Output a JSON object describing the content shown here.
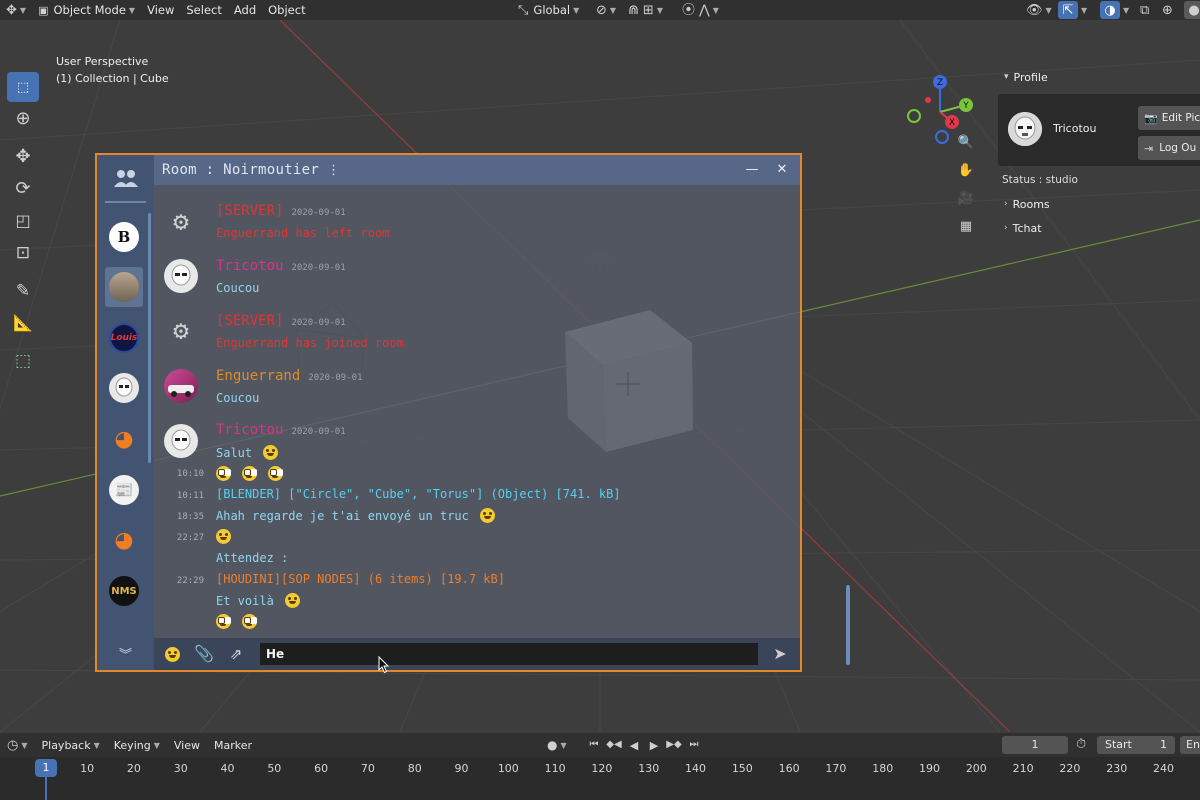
{
  "header": {
    "mode_label": "Object Mode",
    "menus": [
      "View",
      "Select",
      "Add",
      "Object"
    ],
    "transform_orientation": "Global"
  },
  "viewport": {
    "perspective_label": "User Perspective",
    "collection_label": "(1) Collection | Cube",
    "gizmo_axes": [
      "Z",
      "Y",
      "X"
    ]
  },
  "profile": {
    "header": "Profile",
    "username": "Tricotou",
    "edit_picture_label": "Edit Pict",
    "logout_label": "Log Ou",
    "status": "Status : studio",
    "sections": [
      "Rooms",
      "Tchat"
    ]
  },
  "chat": {
    "title": "Room : Noirmoutier",
    "rooms": [
      {
        "icon": "b-logo",
        "label": "B"
      },
      {
        "icon": "photo-avatar",
        "label": ""
      },
      {
        "icon": "louis-logo",
        "label": "Louis"
      },
      {
        "icon": "trooper-avatar",
        "label": ""
      },
      {
        "icon": "blender-logo",
        "label": ""
      },
      {
        "icon": "newspaper-logo",
        "label": ""
      },
      {
        "icon": "blender-logo",
        "label": ""
      },
      {
        "icon": "nms-logo",
        "label": "NMS"
      }
    ],
    "messages": [
      {
        "author": "[SERVER]",
        "date": "2020-09-01",
        "text": "Enguerrand has left room"
      },
      {
        "author": "Tricotou",
        "date": "2020-09-01",
        "text": "Coucou"
      },
      {
        "author": "[SERVER]",
        "date": "2020-09-01",
        "text": "Enguerrand has joined room"
      },
      {
        "author": "Enguerrand",
        "date": "2020-09-01",
        "text": "Coucou"
      },
      {
        "author": "Tricotou",
        "date": "2020-09-01",
        "lines": [
          {
            "time": "",
            "text": "Salut"
          },
          {
            "time": "10:10",
            "text": ""
          },
          {
            "time": "10:11",
            "text": "[BLENDER] [\"Circle\", \"Cube\", \"Torus\"] (Object) [741. kB]"
          },
          {
            "time": "18:35",
            "text": "Ahah regarde je t'ai envoyé un truc"
          },
          {
            "time": "22:27",
            "text": ""
          },
          {
            "time": "",
            "text": "Attendez :"
          },
          {
            "time": "22:29",
            "text": "[HOUDINI][SOP NODES] (6 items)  [19.7 kB]"
          },
          {
            "time": "",
            "text": "Et voilà"
          },
          {
            "time": "",
            "text": ""
          }
        ]
      }
    ],
    "input_value": "He",
    "colors": {
      "server": "#e03535",
      "tricotou": "#e0308a",
      "enguerrand": "#e08a2a",
      "border": "#e1882a"
    }
  },
  "timeline": {
    "menus": [
      "Playback",
      "Keying",
      "View",
      "Marker"
    ],
    "current_frame": "1",
    "start_label": "Start",
    "start_value": "1",
    "end_label": "En",
    "frame_numbers": [
      "1",
      "10",
      "20",
      "30",
      "40",
      "50",
      "60",
      "70",
      "80",
      "90",
      "100",
      "110",
      "120",
      "130",
      "140",
      "150",
      "160",
      "170",
      "180",
      "190",
      "200",
      "210",
      "220",
      "230",
      "240"
    ]
  }
}
